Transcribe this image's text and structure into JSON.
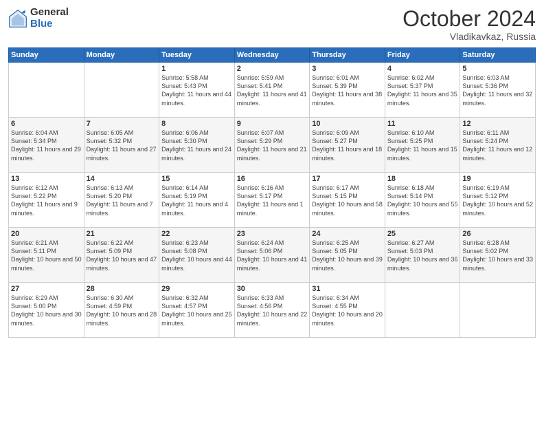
{
  "logo": {
    "general": "General",
    "blue": "Blue"
  },
  "title": "October 2024",
  "location": "Vladikavkaz, Russia",
  "headers": [
    "Sunday",
    "Monday",
    "Tuesday",
    "Wednesday",
    "Thursday",
    "Friday",
    "Saturday"
  ],
  "weeks": [
    [
      {
        "day": "",
        "info": ""
      },
      {
        "day": "",
        "info": ""
      },
      {
        "day": "1",
        "info": "Sunrise: 5:58 AM\nSunset: 5:43 PM\nDaylight: 11 hours and 44 minutes."
      },
      {
        "day": "2",
        "info": "Sunrise: 5:59 AM\nSunset: 5:41 PM\nDaylight: 11 hours and 41 minutes."
      },
      {
        "day": "3",
        "info": "Sunrise: 6:01 AM\nSunset: 5:39 PM\nDaylight: 11 hours and 38 minutes."
      },
      {
        "day": "4",
        "info": "Sunrise: 6:02 AM\nSunset: 5:37 PM\nDaylight: 11 hours and 35 minutes."
      },
      {
        "day": "5",
        "info": "Sunrise: 6:03 AM\nSunset: 5:36 PM\nDaylight: 11 hours and 32 minutes."
      }
    ],
    [
      {
        "day": "6",
        "info": "Sunrise: 6:04 AM\nSunset: 5:34 PM\nDaylight: 11 hours and 29 minutes."
      },
      {
        "day": "7",
        "info": "Sunrise: 6:05 AM\nSunset: 5:32 PM\nDaylight: 11 hours and 27 minutes."
      },
      {
        "day": "8",
        "info": "Sunrise: 6:06 AM\nSunset: 5:30 PM\nDaylight: 11 hours and 24 minutes."
      },
      {
        "day": "9",
        "info": "Sunrise: 6:07 AM\nSunset: 5:29 PM\nDaylight: 11 hours and 21 minutes."
      },
      {
        "day": "10",
        "info": "Sunrise: 6:09 AM\nSunset: 5:27 PM\nDaylight: 11 hours and 18 minutes."
      },
      {
        "day": "11",
        "info": "Sunrise: 6:10 AM\nSunset: 5:25 PM\nDaylight: 11 hours and 15 minutes."
      },
      {
        "day": "12",
        "info": "Sunrise: 6:11 AM\nSunset: 5:24 PM\nDaylight: 11 hours and 12 minutes."
      }
    ],
    [
      {
        "day": "13",
        "info": "Sunrise: 6:12 AM\nSunset: 5:22 PM\nDaylight: 11 hours and 9 minutes."
      },
      {
        "day": "14",
        "info": "Sunrise: 6:13 AM\nSunset: 5:20 PM\nDaylight: 11 hours and 7 minutes."
      },
      {
        "day": "15",
        "info": "Sunrise: 6:14 AM\nSunset: 5:19 PM\nDaylight: 11 hours and 4 minutes."
      },
      {
        "day": "16",
        "info": "Sunrise: 6:16 AM\nSunset: 5:17 PM\nDaylight: 11 hours and 1 minute."
      },
      {
        "day": "17",
        "info": "Sunrise: 6:17 AM\nSunset: 5:15 PM\nDaylight: 10 hours and 58 minutes."
      },
      {
        "day": "18",
        "info": "Sunrise: 6:18 AM\nSunset: 5:14 PM\nDaylight: 10 hours and 55 minutes."
      },
      {
        "day": "19",
        "info": "Sunrise: 6:19 AM\nSunset: 5:12 PM\nDaylight: 10 hours and 52 minutes."
      }
    ],
    [
      {
        "day": "20",
        "info": "Sunrise: 6:21 AM\nSunset: 5:11 PM\nDaylight: 10 hours and 50 minutes."
      },
      {
        "day": "21",
        "info": "Sunrise: 6:22 AM\nSunset: 5:09 PM\nDaylight: 10 hours and 47 minutes."
      },
      {
        "day": "22",
        "info": "Sunrise: 6:23 AM\nSunset: 5:08 PM\nDaylight: 10 hours and 44 minutes."
      },
      {
        "day": "23",
        "info": "Sunrise: 6:24 AM\nSunset: 5:06 PM\nDaylight: 10 hours and 41 minutes."
      },
      {
        "day": "24",
        "info": "Sunrise: 6:25 AM\nSunset: 5:05 PM\nDaylight: 10 hours and 39 minutes."
      },
      {
        "day": "25",
        "info": "Sunrise: 6:27 AM\nSunset: 5:03 PM\nDaylight: 10 hours and 36 minutes."
      },
      {
        "day": "26",
        "info": "Sunrise: 6:28 AM\nSunset: 5:02 PM\nDaylight: 10 hours and 33 minutes."
      }
    ],
    [
      {
        "day": "27",
        "info": "Sunrise: 6:29 AM\nSunset: 5:00 PM\nDaylight: 10 hours and 30 minutes."
      },
      {
        "day": "28",
        "info": "Sunrise: 6:30 AM\nSunset: 4:59 PM\nDaylight: 10 hours and 28 minutes."
      },
      {
        "day": "29",
        "info": "Sunrise: 6:32 AM\nSunset: 4:57 PM\nDaylight: 10 hours and 25 minutes."
      },
      {
        "day": "30",
        "info": "Sunrise: 6:33 AM\nSunset: 4:56 PM\nDaylight: 10 hours and 22 minutes."
      },
      {
        "day": "31",
        "info": "Sunrise: 6:34 AM\nSunset: 4:55 PM\nDaylight: 10 hours and 20 minutes."
      },
      {
        "day": "",
        "info": ""
      },
      {
        "day": "",
        "info": ""
      }
    ]
  ]
}
